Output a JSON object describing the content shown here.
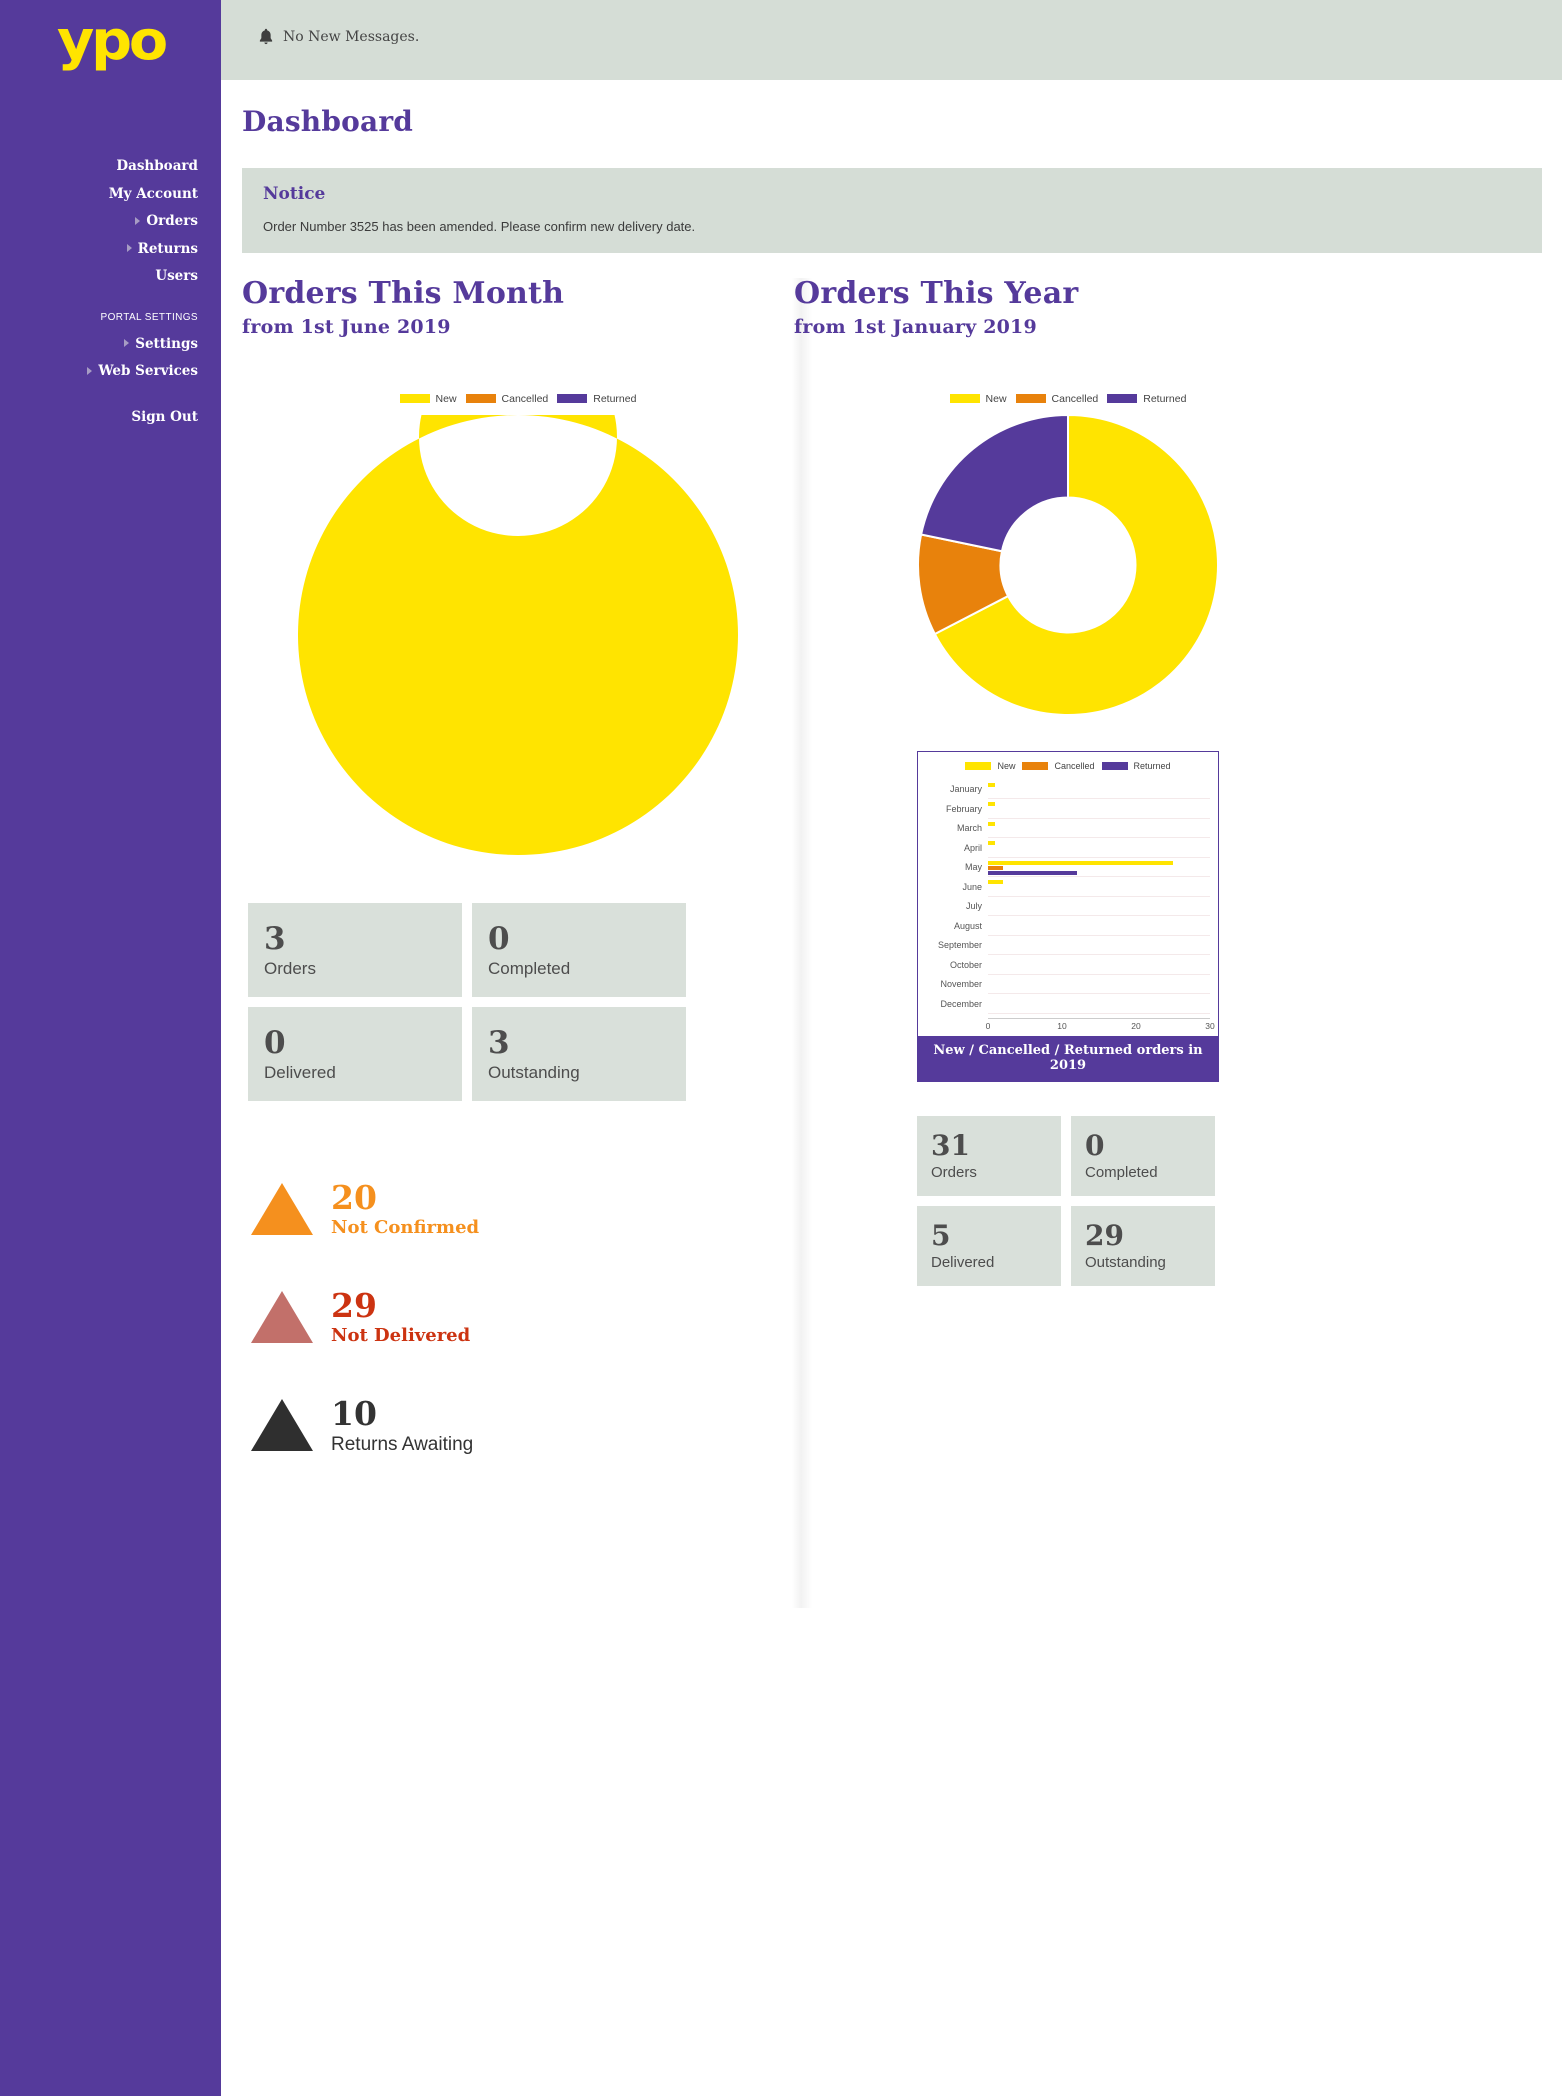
{
  "brand": {
    "logo_text": "ypo",
    "logo_registered": "®",
    "purple": "#553a9b",
    "yellow": "#ffe400",
    "orange": "#e8820c",
    "grey_panel": "#d5ddd6"
  },
  "topbar": {
    "bell_icon": "bell-icon",
    "messages": "No New Messages."
  },
  "sidebar": {
    "items": [
      {
        "label": "Dashboard",
        "caret": false,
        "active": true
      },
      {
        "label": "My Account",
        "caret": false,
        "active": false
      },
      {
        "label": "Orders",
        "caret": true,
        "active": false
      },
      {
        "label": "Returns",
        "caret": true,
        "active": false
      },
      {
        "label": "Users",
        "caret": false,
        "active": false
      }
    ],
    "group_label": "PORTAL SETTINGS",
    "settings_items": [
      {
        "label": "Settings",
        "caret": true
      },
      {
        "label": "Web Services",
        "caret": true
      }
    ],
    "sign_out": "Sign Out"
  },
  "page": {
    "title": "Dashboard"
  },
  "notice": {
    "title": "Notice",
    "body": "Order Number 3525 has been amended. Please confirm new delivery date."
  },
  "month_section": {
    "title": "Orders This Month",
    "subtitle": "from 1st June 2019",
    "tiles": [
      {
        "num": "3",
        "label": "Orders"
      },
      {
        "num": "0",
        "label": "Completed"
      },
      {
        "num": "0",
        "label": "Delivered"
      },
      {
        "num": "3",
        "label": "Outstanding"
      }
    ]
  },
  "year_section": {
    "title": "Orders This Year",
    "subtitle": "from 1st January 2019",
    "tiles": [
      {
        "num": "31",
        "label": "Orders"
      },
      {
        "num": "0",
        "label": "Completed"
      },
      {
        "num": "5",
        "label": "Delivered"
      },
      {
        "num": "29",
        "label": "Outstanding"
      }
    ]
  },
  "alerts": [
    {
      "num": "20",
      "label": "Not Confirmed",
      "color": "#f5901e",
      "text_color": "#f5901e"
    },
    {
      "num": "29",
      "label": "Not Delivered",
      "color": "#c2706a",
      "text_color": "#cc3311"
    },
    {
      "num": "10",
      "label": "Returns Awaiting",
      "color": "#2f2f2f",
      "text_color": "#333333"
    }
  ],
  "chart_data": [
    {
      "type": "pie",
      "id": "orders-this-month-donut",
      "title": "Orders This Month",
      "subtitle": "from 1st June 2019",
      "legend_position": "top",
      "labels": [
        "New",
        "Cancelled",
        "Returned"
      ],
      "colors": [
        "#ffe400",
        "#e8820c",
        "#553a9b"
      ],
      "values": [
        3,
        0,
        0
      ],
      "donut": true,
      "inner_radius_ratio": 0.45
    },
    {
      "type": "pie",
      "id": "orders-this-year-donut",
      "title": "Orders This Year",
      "subtitle": "from 1st January 2019",
      "legend_position": "top",
      "labels": [
        "New",
        "Cancelled",
        "Returned"
      ],
      "colors": [
        "#ffe400",
        "#e8820c",
        "#553a9b"
      ],
      "values": [
        31,
        5,
        10
      ],
      "donut": true,
      "inner_radius_ratio": 0.45
    },
    {
      "type": "bar",
      "id": "monthly-orders-bar",
      "orientation": "horizontal",
      "caption": "New / Cancelled / Returned orders in 2019",
      "legend_position": "top",
      "categories": [
        "January",
        "February",
        "March",
        "April",
        "May",
        "June",
        "July",
        "August",
        "September",
        "October",
        "November",
        "December"
      ],
      "xlabel": "",
      "ylabel": "",
      "xlim": [
        0,
        30
      ],
      "xticks": [
        "0",
        "10",
        "20",
        "30"
      ],
      "grid": true,
      "series": [
        {
          "name": "New",
          "color": "#ffe400",
          "values": [
            1,
            1,
            1,
            1,
            25,
            2,
            0,
            0,
            0,
            0,
            0,
            0
          ]
        },
        {
          "name": "Cancelled",
          "color": "#e8820c",
          "values": [
            0,
            0,
            0,
            0,
            2,
            0,
            0,
            0,
            0,
            0,
            0,
            0
          ]
        },
        {
          "name": "Returned",
          "color": "#553a9b",
          "values": [
            0,
            0,
            0,
            0,
            12,
            0,
            0,
            0,
            0,
            0,
            0,
            0
          ]
        }
      ]
    }
  ]
}
